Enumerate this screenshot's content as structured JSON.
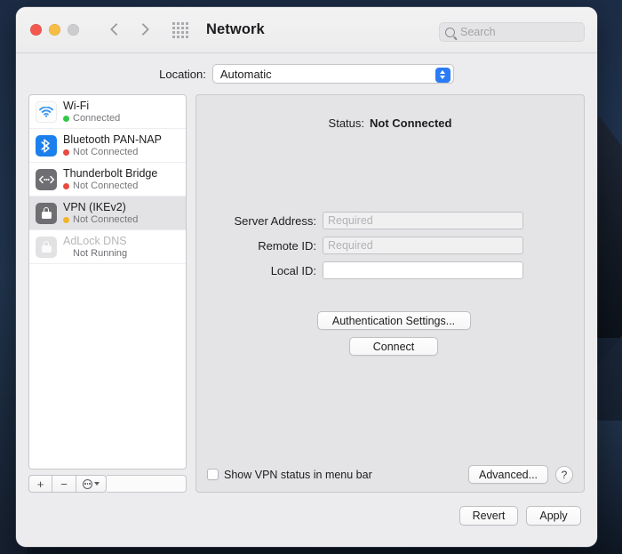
{
  "window": {
    "title": "Network",
    "traffic_lights": [
      "close",
      "minimize",
      "zoom"
    ],
    "nav": {
      "back_icon": "chevron-left-icon",
      "forward_icon": "chevron-right-icon",
      "grid_icon": "show-all-grid-icon"
    }
  },
  "search": {
    "placeholder": "Search",
    "icon": "search-icon"
  },
  "location": {
    "label": "Location:",
    "value": "Automatic",
    "options": [
      "Automatic"
    ]
  },
  "sidebar": {
    "services": [
      {
        "name": "Wi-Fi",
        "status": "Connected",
        "dot": "#33c748",
        "icon": "wifi-icon",
        "selected": false,
        "disabled": false
      },
      {
        "name": "Bluetooth PAN-NAP",
        "status": "Not Connected",
        "dot": "#ea4a40",
        "icon": "bluetooth-icon",
        "selected": false,
        "disabled": false
      },
      {
        "name": "Thunderbolt Bridge",
        "status": "Not Connected",
        "dot": "#ea4a40",
        "icon": "thunderbolt-bridge-icon",
        "selected": false,
        "disabled": false
      },
      {
        "name": "VPN (IKEv2)",
        "status": "Not Connected",
        "dot": "#f0b52c",
        "icon": "vpn-lock-icon",
        "selected": true,
        "disabled": false
      },
      {
        "name": "AdLock DNS",
        "status": "Not Running",
        "dot": "",
        "icon": "dns-lock-icon",
        "selected": false,
        "disabled": true
      }
    ],
    "toolbar": {
      "add_label": "+",
      "remove_label": "−",
      "more_icon": "action-gear-icon",
      "more_chevron_icon": "chevron-down-icon"
    }
  },
  "detail": {
    "status_label": "Status:",
    "status_value": "Not Connected",
    "fields": [
      {
        "label": "Server Address:",
        "value": "",
        "placeholder": "Required",
        "shaded": true
      },
      {
        "label": "Remote ID:",
        "value": "",
        "placeholder": "Required",
        "shaded": true
      },
      {
        "label": "Local ID:",
        "value": "",
        "placeholder": "",
        "shaded": false
      }
    ],
    "auth_settings_label": "Authentication Settings...",
    "connect_label": "Connect",
    "show_vpn_label": "Show VPN status in menu bar",
    "show_vpn_checked": false,
    "advanced_label": "Advanced...",
    "help_label": "?"
  },
  "footer": {
    "revert_label": "Revert",
    "apply_label": "Apply"
  },
  "colors": {
    "accent": "#2a7cf6",
    "connected": "#33c748",
    "not_connected": "#ea4a40",
    "pending": "#f0b52c",
    "window_bg": "#ececee",
    "panel_bg": "#e4e4e6"
  }
}
